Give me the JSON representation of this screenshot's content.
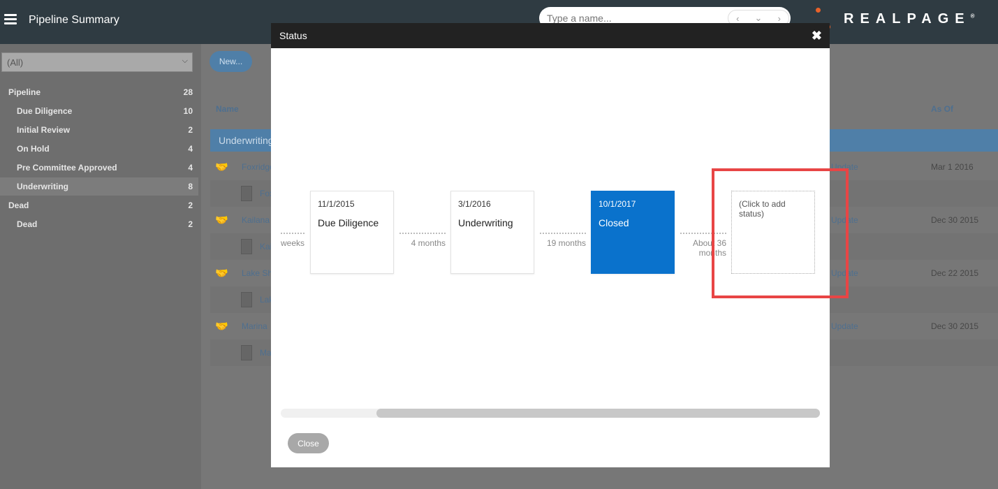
{
  "header": {
    "app_title": "Pipeline Summary",
    "search_placeholder": "Type a name...",
    "nav_prev": "‹",
    "nav_down": "⌄",
    "nav_next": "›",
    "brand": "REALPAGE",
    "brand_mark": "®"
  },
  "sidebar": {
    "filter_value": "(All)",
    "items": [
      {
        "label": "Pipeline",
        "count": "28",
        "level": 0
      },
      {
        "label": "Due Diligence",
        "count": "10",
        "level": 1
      },
      {
        "label": "Initial Review",
        "count": "2",
        "level": 1
      },
      {
        "label": "On Hold",
        "count": "4",
        "level": 1
      },
      {
        "label": "Pre Committee Approved",
        "count": "4",
        "level": 1
      },
      {
        "label": "Underwriting",
        "count": "8",
        "level": 1,
        "selected": true
      },
      {
        "label": "Dead",
        "count": "2",
        "level": 0
      },
      {
        "label": "Dead",
        "count": "2",
        "level": 1
      }
    ]
  },
  "main": {
    "new_label": "New...",
    "columns": {
      "name": "Name",
      "as_of": "As Of"
    },
    "group_label": "Underwriting",
    "rows": [
      {
        "deal": "Foxridge",
        "prop": "Fox",
        "update": "Update",
        "as_of": "Mar 1 2016"
      },
      {
        "deal": "Kailana",
        "prop": "Kai",
        "update": "Update",
        "as_of": "Dec 30 2015"
      },
      {
        "deal": "Lake Sh",
        "prop": "Lak",
        "update": "Update",
        "as_of": "Dec 22 2015"
      },
      {
        "deal": "Marina",
        "prop": "Ma",
        "update": "Update",
        "as_of": "Dec 30 2015"
      }
    ]
  },
  "modal": {
    "title": "Status",
    "close_x": "✖",
    "lead_duration": "weeks",
    "statuses": [
      {
        "date": "11/1/2015",
        "name": "Due Diligence",
        "active": false
      },
      {
        "date": "3/1/2016",
        "name": "Underwriting",
        "active": false
      },
      {
        "date": "10/1/2017",
        "name": "Closed",
        "active": true
      }
    ],
    "durations": [
      "4 months",
      "19 months",
      "About 36 months"
    ],
    "add_status": "(Click to add status)",
    "close_label": "Close"
  },
  "colors": {
    "topbar": "#2f3b42",
    "active_status": "#0a72cc",
    "highlight": "#e84545",
    "brand_dot": "#e8622a"
  }
}
